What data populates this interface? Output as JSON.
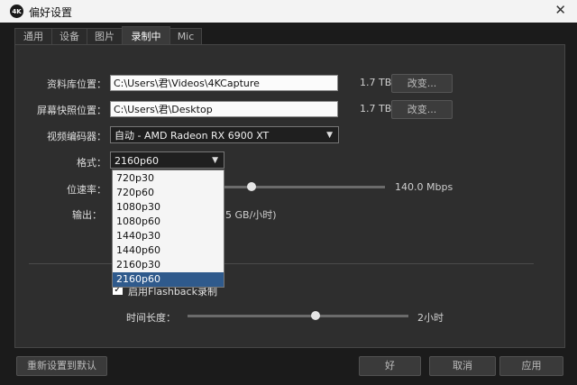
{
  "window": {
    "title": "偏好设置",
    "app_icon": "4K",
    "close_glyph": "✕"
  },
  "tabs": [
    {
      "label": "通用"
    },
    {
      "label": "设备"
    },
    {
      "label": "图片"
    },
    {
      "label": "录制中",
      "active": true
    },
    {
      "label": "Mic"
    }
  ],
  "library": {
    "label": "资料库位置：",
    "path": "C:\\Users\\君\\Videos\\4KCapture",
    "size": "1.7 TB",
    "change_label": "改变..."
  },
  "snapshot": {
    "label": "屏幕快照位置：",
    "path": "C:\\Users\\君\\Desktop",
    "size": "1.7 TB",
    "change_label": "改变..."
  },
  "encoder": {
    "label": "视频编码器：",
    "value": "自动 - AMD Radeon RX 6900 XT"
  },
  "format": {
    "label": "格式：",
    "value": "2160p60",
    "options": [
      "720p30",
      "720p60",
      "1080p30",
      "1080p60",
      "1440p30",
      "1440p60",
      "2160p30",
      "2160p60"
    ],
    "selected_index": 7
  },
  "bitrate": {
    "label": "位速率：",
    "value": "140.0 Mbps",
    "level": 0.5
  },
  "output": {
    "label": "输出：",
    "value_partial": "5 GB/小时)"
  },
  "flashback": {
    "checkbox_label": "启用Flashback录制",
    "checked": true
  },
  "duration": {
    "label": "时间长度：",
    "value": "2小时",
    "level": 0.58
  },
  "footer": {
    "reset_label": "重新设置到默认",
    "ok_label": "好",
    "cancel_label": "取消",
    "apply_label": "应用"
  },
  "colors": {
    "accent": "#2f5a8c",
    "panel": "#2e2e2e",
    "window_bg": "#1b1b1b"
  }
}
